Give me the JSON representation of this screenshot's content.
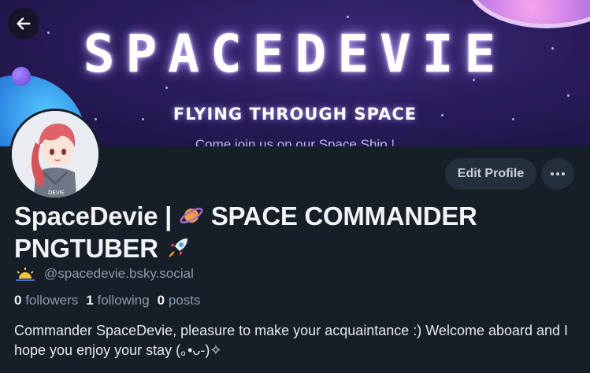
{
  "banner": {
    "title": "SPACEDEVIE",
    "subtitle": "FLYING THROUGH SPACE",
    "tagline": "Come join us on our Space Ship !"
  },
  "profile": {
    "display_name": "SpaceDevie | 🪐 SPACE COMMANDER PNGTUBER 🚀",
    "name_part1": "SpaceDevie | ",
    "name_part2": " SPACE COMMANDER PNGTUBER ",
    "handle": "@spacedevie.bsky.social",
    "avatar_label": "DEVIE",
    "bio": "Commander SpaceDevie, pleasure to make your acquaintance :) Welcome aboard and I hope you enjoy your stay (｡•ᴗ-)✧"
  },
  "stats": {
    "followers_count": "0",
    "followers_label": "followers",
    "following_count": "1",
    "following_label": "following",
    "posts_count": "0",
    "posts_label": "posts"
  },
  "actions": {
    "edit_profile_label": "Edit Profile"
  },
  "icons": {
    "back": "back-arrow-icon",
    "more": "more-dots-icon",
    "planet": "planet-emoji-icon",
    "rocket": "rocket-emoji-icon",
    "sun": "sunrise-icon"
  },
  "colors": {
    "background": "#161e27",
    "button_bg": "#242f3c",
    "muted_text": "#8d9aa9"
  }
}
